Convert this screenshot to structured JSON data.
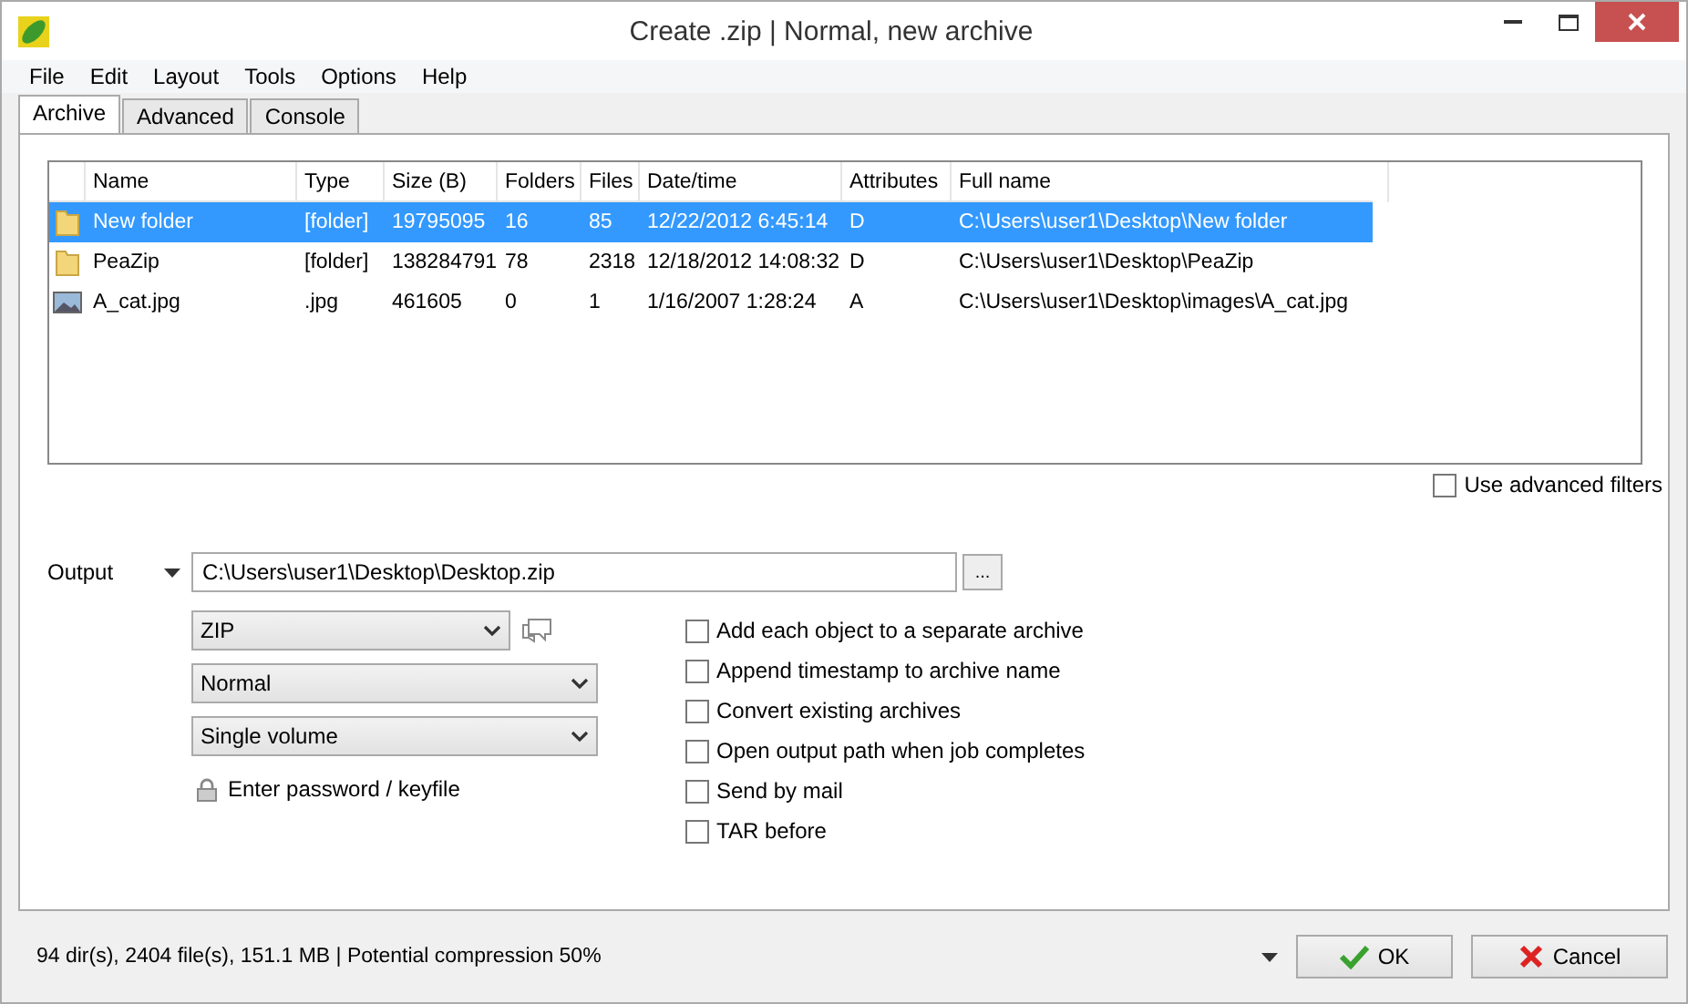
{
  "window": {
    "title": "Create .zip | Normal, new archive"
  },
  "menu": [
    "File",
    "Edit",
    "Layout",
    "Tools",
    "Options",
    "Help"
  ],
  "tabs": [
    {
      "label": "Archive",
      "selected": true
    },
    {
      "label": "Advanced",
      "selected": false
    },
    {
      "label": "Console",
      "selected": false
    }
  ],
  "table": {
    "columns": [
      "Name",
      "Type",
      "Size (B)",
      "Folders",
      "Files",
      "Date/time",
      "Attributes",
      "Full name"
    ],
    "rows": [
      {
        "kind": "folder",
        "selected": true,
        "cells": [
          "New folder",
          "[folder]",
          "19795095",
          "16",
          "85",
          "12/22/2012 6:45:14",
          "D",
          "C:\\Users\\user1\\Desktop\\New folder"
        ]
      },
      {
        "kind": "folder",
        "selected": false,
        "cells": [
          "PeaZip",
          "[folder]",
          "138284791",
          "78",
          "2318",
          "12/18/2012 14:08:32",
          "D",
          "C:\\Users\\user1\\Desktop\\PeaZip"
        ]
      },
      {
        "kind": "image",
        "selected": false,
        "cells": [
          "A_cat.jpg",
          ".jpg",
          "461605",
          "0",
          "1",
          "1/16/2007 1:28:24",
          "A",
          "C:\\Users\\user1\\Desktop\\images\\A_cat.jpg"
        ]
      }
    ]
  },
  "advanced_filters": {
    "label": "Use advanced filters",
    "checked": false
  },
  "output": {
    "label": "Output",
    "value": "C:\\Users\\user1\\Desktop\\Desktop.zip",
    "browse": "..."
  },
  "selects": [
    {
      "value": "ZIP"
    },
    {
      "value": "Normal"
    },
    {
      "value": "Single volume"
    }
  ],
  "password": "Enter password / keyfile",
  "options": [
    {
      "label": "Add each object to a separate archive",
      "checked": false
    },
    {
      "label": "Append timestamp to archive name",
      "checked": false
    },
    {
      "label": "Convert existing archives",
      "checked": false
    },
    {
      "label": "Open output path when job completes",
      "checked": false
    },
    {
      "label": "Send by mail",
      "checked": false
    },
    {
      "label": "TAR before",
      "checked": false
    }
  ],
  "status_bar": {
    "text": "94 dir(s), 2404 file(s), 151.1 MB | Potential compression 50%"
  },
  "buttons": [
    {
      "kind": "ok",
      "label": "OK"
    },
    {
      "kind": "cancel",
      "label": "Cancel"
    }
  ]
}
